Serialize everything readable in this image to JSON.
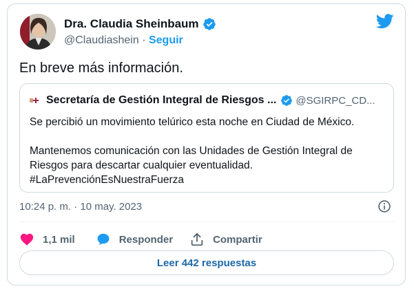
{
  "author": {
    "name": "Dra. Claudia Sheinbaum",
    "handle": "@Claudiashein",
    "separator": "·",
    "follow_label": "Seguir"
  },
  "tweet": {
    "text": "En breve más información.",
    "timestamp": "10:24 p. m. · 10 may. 2023"
  },
  "quoted": {
    "name": "Secretaría de Gestión Integral de Riesgos ...",
    "handle": "@SGIRPC_CD...",
    "line1": "Se percibió un movimiento telúrico esta noche en Ciudad de México.",
    "line2": "Mantenemos comunicación con las Unidades de Gestión Integral de Riesgos para descartar cualquier eventualidad.",
    "hashtag": "#LaPrevenciónEsNuestraFuerza"
  },
  "actions": {
    "like_count": "1,1 mil",
    "reply_label": "Responder",
    "share_label": "Compartir"
  },
  "replies_button": "Leer 442 respuestas",
  "colors": {
    "accent": "#1d9bf0",
    "like": "#f91880",
    "text": "#0f1419",
    "muted": "#536471",
    "border": "#cfd9de"
  },
  "icons": [
    "twitter-bird-icon",
    "verified-badge-icon",
    "info-icon",
    "heart-icon",
    "reply-bubble-icon",
    "share-icon"
  ]
}
